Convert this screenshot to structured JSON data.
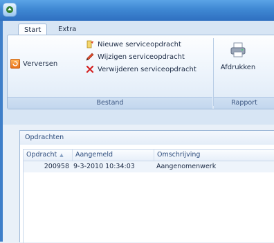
{
  "window": {
    "app_icon": "app-logo-icon"
  },
  "tabs": [
    {
      "label": "Start",
      "active": true
    },
    {
      "label": "Extra",
      "active": false
    }
  ],
  "ribbon": {
    "groups": {
      "bestand": {
        "label": "Bestand",
        "refresh_label": "Verversen",
        "new_label": "Nieuwe serviceopdracht",
        "edit_label": "Wijzigen serviceopdracht",
        "delete_label": "Verwijderen serviceopdracht"
      },
      "rapport": {
        "label": "Rapport",
        "print_label": "Afdrukken"
      }
    }
  },
  "panel": {
    "title": "Opdrachten",
    "columns": [
      "Opdracht",
      "Aangemeld",
      "Omschrijving"
    ],
    "rows": [
      {
        "opdracht": "200958",
        "aangemeld": "9-3-2010 10:34:03",
        "omschrijving": "Aangenomenwerk"
      }
    ]
  },
  "colors": {
    "titlebar": "#3f88d3",
    "ribbon_bg": "#eaf2fb",
    "accent_orange": "#e7711a",
    "delete_red": "#d42020"
  }
}
